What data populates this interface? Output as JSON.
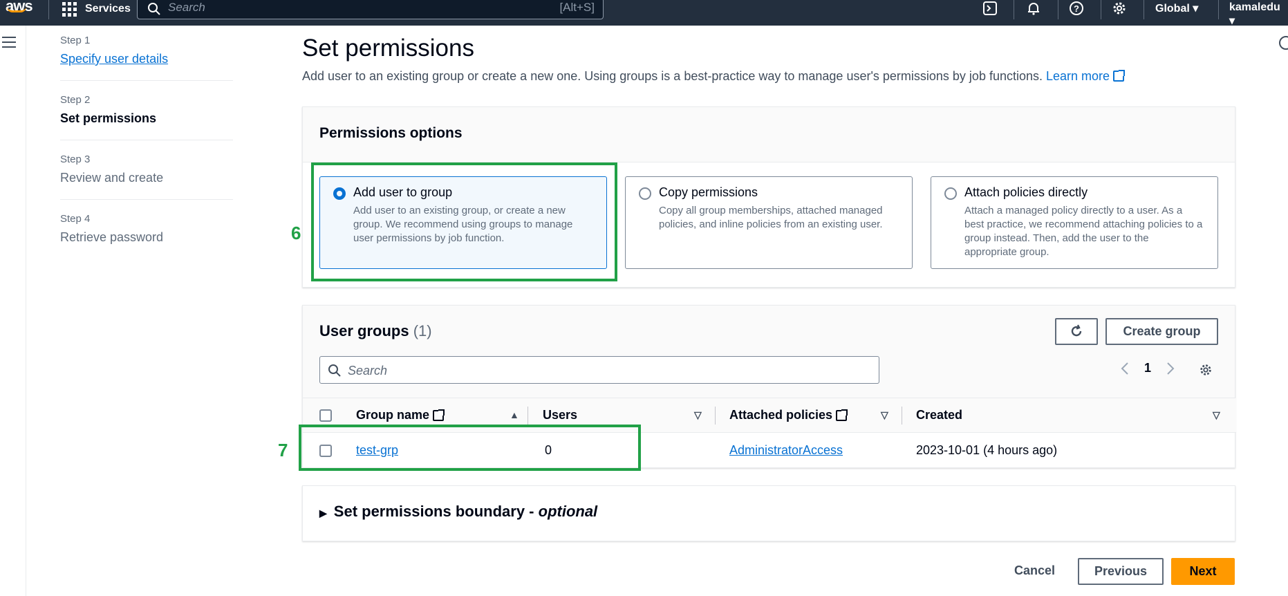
{
  "topbar": {
    "logo": "aws",
    "services_label": "Services",
    "search_placeholder": "Search",
    "search_shortcut": "[Alt+S]",
    "region": "Global ▾",
    "user": "kamaledu ▾",
    "icons": [
      "cloudshell-icon",
      "bell-icon",
      "help-icon",
      "gear-icon"
    ]
  },
  "steps": [
    {
      "no": "Step 1",
      "title": "Specify user details",
      "state": "link"
    },
    {
      "no": "Step 2",
      "title": "Set permissions",
      "state": "current"
    },
    {
      "no": "Step 3",
      "title": "Review and create",
      "state": "disabled"
    },
    {
      "no": "Step 4",
      "title": "Retrieve password",
      "state": "disabled"
    }
  ],
  "page": {
    "title": "Set permissions",
    "description": "Add user to an existing group or create a new one. Using groups is a best-practice way to manage user's permissions by job functions.",
    "learn_more": "Learn more"
  },
  "permissions": {
    "heading": "Permissions options",
    "options": [
      {
        "title": "Add user to group",
        "desc": "Add user to an existing group, or create a new group. We recommend using groups to manage user permissions by job function.",
        "selected": true
      },
      {
        "title": "Copy permissions",
        "desc": "Copy all group memberships, attached managed policies, and inline policies from an existing user.",
        "selected": false
      },
      {
        "title": "Attach policies directly",
        "desc": "Attach a managed policy directly to a user. As a best practice, we recommend attaching policies to a group instead. Then, add the user to the appropriate group.",
        "selected": false
      }
    ]
  },
  "user_groups": {
    "heading": "User groups",
    "count": "(1)",
    "refresh_icon": "refresh-icon",
    "create_label": "Create group",
    "search_placeholder": "Search",
    "page": "1",
    "columns": [
      "Group name",
      "Users",
      "Attached policies",
      "Created"
    ],
    "rows": [
      {
        "name": "test-grp",
        "users": "0",
        "policies": "AdministratorAccess",
        "created": "2023-10-01 (4 hours ago)"
      }
    ]
  },
  "boundary": {
    "title": "Set permissions boundary - ",
    "optional": "optional"
  },
  "footer": {
    "cancel": "Cancel",
    "previous": "Previous",
    "next": "Next"
  },
  "annotations": [
    "6",
    "7"
  ],
  "colors": {
    "accent": "#0972d3",
    "primary_button": "#ff9900",
    "annotation": "#21a147",
    "topbar": "#232f3e"
  }
}
